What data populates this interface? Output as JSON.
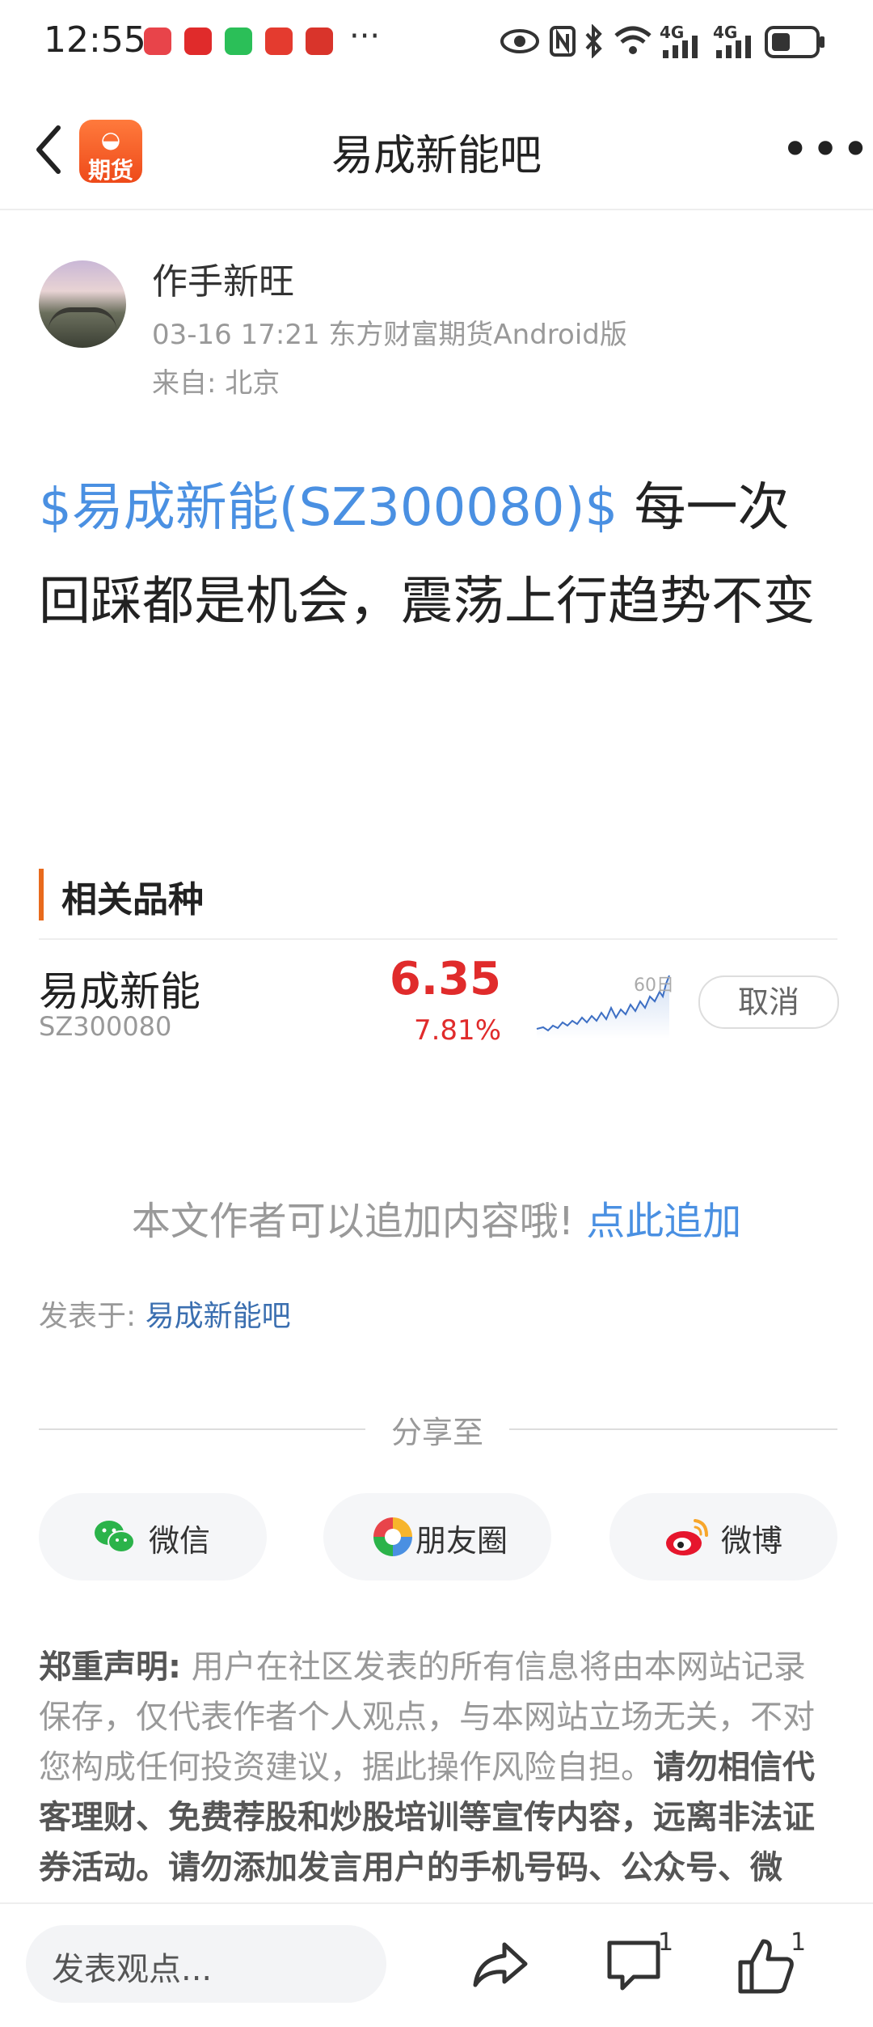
{
  "status_bar": {
    "time": "12:55",
    "more": "···",
    "network": "4G",
    "network2": "4G",
    "app_icons": [
      {
        "name": "huawei-icon",
        "color": "#e8444a",
        "label": "HUAWEI"
      },
      {
        "name": "app2-icon",
        "color": "#e02b2b",
        "label": "小红书"
      },
      {
        "name": "wechat-icon",
        "color": "#2bbf58",
        "label": ""
      },
      {
        "name": "app4-icon",
        "color": "#e43b2f",
        "label": ""
      },
      {
        "name": "app5-icon",
        "color": "#d9342b",
        "label": ""
      }
    ]
  },
  "header": {
    "title": "易成新能吧",
    "logo_text": "期货",
    "more_label": "•••"
  },
  "post": {
    "author": "作手新旺",
    "meta": "03-16 17:21 东方财富期货Android版",
    "from": "来自: 北京",
    "stock_link": "$易成新能(SZ300080)$",
    "content": "  每一次回踩都是机会，震荡上行趋势不变"
  },
  "related": {
    "title": "相关品种",
    "stock_name": "易成新能",
    "stock_code": "SZ300080",
    "price": "6.35",
    "change": "7.81%",
    "chart_label": "60日",
    "cancel_label": "取消",
    "price_color": "#e02b2b"
  },
  "append": {
    "text": "本文作者可以追加内容哦!",
    "link": "点此追加"
  },
  "posted_in": {
    "label": "发表于: ",
    "link": "易成新能吧"
  },
  "share": {
    "label": "分享至",
    "buttons": [
      {
        "label": "微信",
        "icon": "wechat-icon"
      },
      {
        "label": "朋友圈",
        "icon": "moments-icon"
      },
      {
        "label": "微博",
        "icon": "weibo-icon"
      }
    ]
  },
  "disclaimer": {
    "head": "郑重声明:",
    "body": "用户在社区发表的所有信息将由本网站记录保存，仅代表作者个人观点，与本网站立场无关，不对您构成任何投资建议，据此操作风险自担。",
    "bold": "请勿相信代客理财、免费荐股和炒股培训等宣传内容，远离非法证券活动。请勿添加发言用户的手机号码、公众号、微"
  },
  "bottom_bar": {
    "comment_placeholder": "发表观点...",
    "comment_count": "1",
    "like_count": "1"
  }
}
